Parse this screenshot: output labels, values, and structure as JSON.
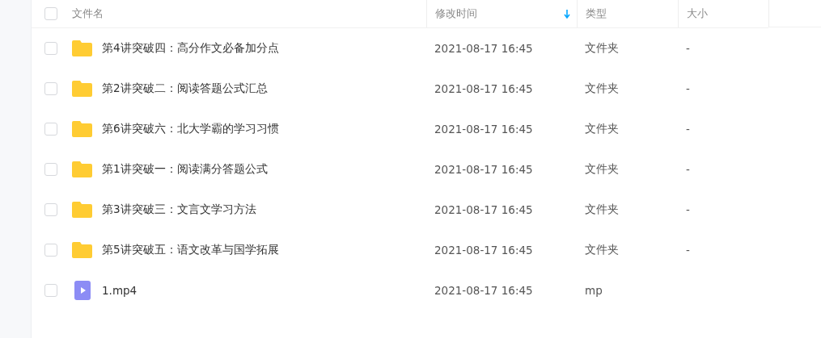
{
  "table": {
    "columns": [
      {
        "label": "文件名",
        "sorted": false
      },
      {
        "label": "修改时间",
        "sorted": true
      },
      {
        "label": "类型",
        "sorted": false
      },
      {
        "label": "大小",
        "sorted": false
      }
    ],
    "select_all": {
      "checked": false
    },
    "rows": [
      {
        "kind": "folder",
        "checked": false,
        "name": "第4讲突破四：高分作文必备加分点",
        "modified": "2021-08-17 16:45",
        "type": "文件夹",
        "size": "-"
      },
      {
        "kind": "folder",
        "checked": false,
        "name": "第2讲突破二：阅读答题公式汇总",
        "modified": "2021-08-17 16:45",
        "type": "文件夹",
        "size": "-"
      },
      {
        "kind": "folder",
        "checked": false,
        "name": "第6讲突破六：北大学霸的学习习惯",
        "modified": "2021-08-17 16:45",
        "type": "文件夹",
        "size": "-"
      },
      {
        "kind": "folder",
        "checked": false,
        "name": "第1讲突破一：阅读满分答题公式",
        "modified": "2021-08-17 16:45",
        "type": "文件夹",
        "size": "-"
      },
      {
        "kind": "folder",
        "checked": false,
        "name": "第3讲突破三：文言文学习方法",
        "modified": "2021-08-17 16:45",
        "type": "文件夹",
        "size": "-"
      },
      {
        "kind": "folder",
        "checked": false,
        "name": "第5讲突破五：语文改革与国学拓展",
        "modified": "2021-08-17 16:45",
        "type": "文件夹",
        "size": "-"
      },
      {
        "kind": "video",
        "checked": false,
        "name": "1.mp4",
        "modified": "2021-08-17 16:45",
        "type": "mp"
      }
    ]
  }
}
